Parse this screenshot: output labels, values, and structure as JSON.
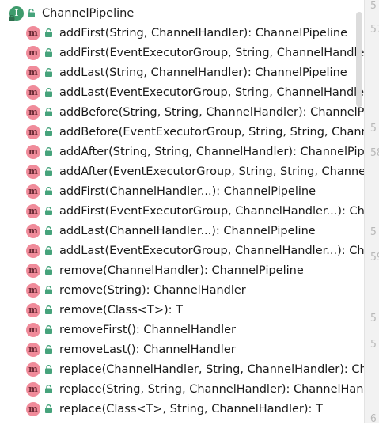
{
  "tree": {
    "root": {
      "icon": "interface-icon",
      "icon_letter": "I",
      "label": "ChannelPipeline"
    },
    "method_icon_letter": "m",
    "methods": [
      "addFirst(String, ChannelHandler): ChannelPipeline",
      "addFirst(EventExecutorGroup, String, ChannelHandle",
      "addLast(String, ChannelHandler): ChannelPipeline",
      "addLast(EventExecutorGroup, String, ChannelHandle",
      "addBefore(String, String, ChannelHandler): ChannelP",
      "addBefore(EventExecutorGroup, String, String, Chann",
      "addAfter(String, String, ChannelHandler): ChannelPip",
      "addAfter(EventExecutorGroup, String, String, Channe",
      "addFirst(ChannelHandler...): ChannelPipeline",
      "addFirst(EventExecutorGroup, ChannelHandler...): Ch",
      "addLast(ChannelHandler...): ChannelPipeline",
      "addLast(EventExecutorGroup, ChannelHandler...): Ch",
      "remove(ChannelHandler): ChannelPipeline",
      "remove(String): ChannelHandler",
      "remove(Class<T>): T",
      "removeFirst(): ChannelHandler",
      "removeLast(): ChannelHandler",
      "replace(ChannelHandler, String, ChannelHandler): Ch",
      "replace(String, String, ChannelHandler): ChannelHan",
      "replace(Class<T>, String, ChannelHandler): T"
    ]
  },
  "colors": {
    "interface_icon": "#3e9b6c",
    "method_icon": "#f08b9a",
    "lock_icon": "#46a37b",
    "gutter_bg": "#f2f2f2",
    "line_number": "#b9b9b9"
  },
  "gutter": {
    "line_numbers": [
      "5",
      "57",
      "5",
      "58",
      "5",
      "59",
      "5",
      "5",
      "6"
    ]
  }
}
